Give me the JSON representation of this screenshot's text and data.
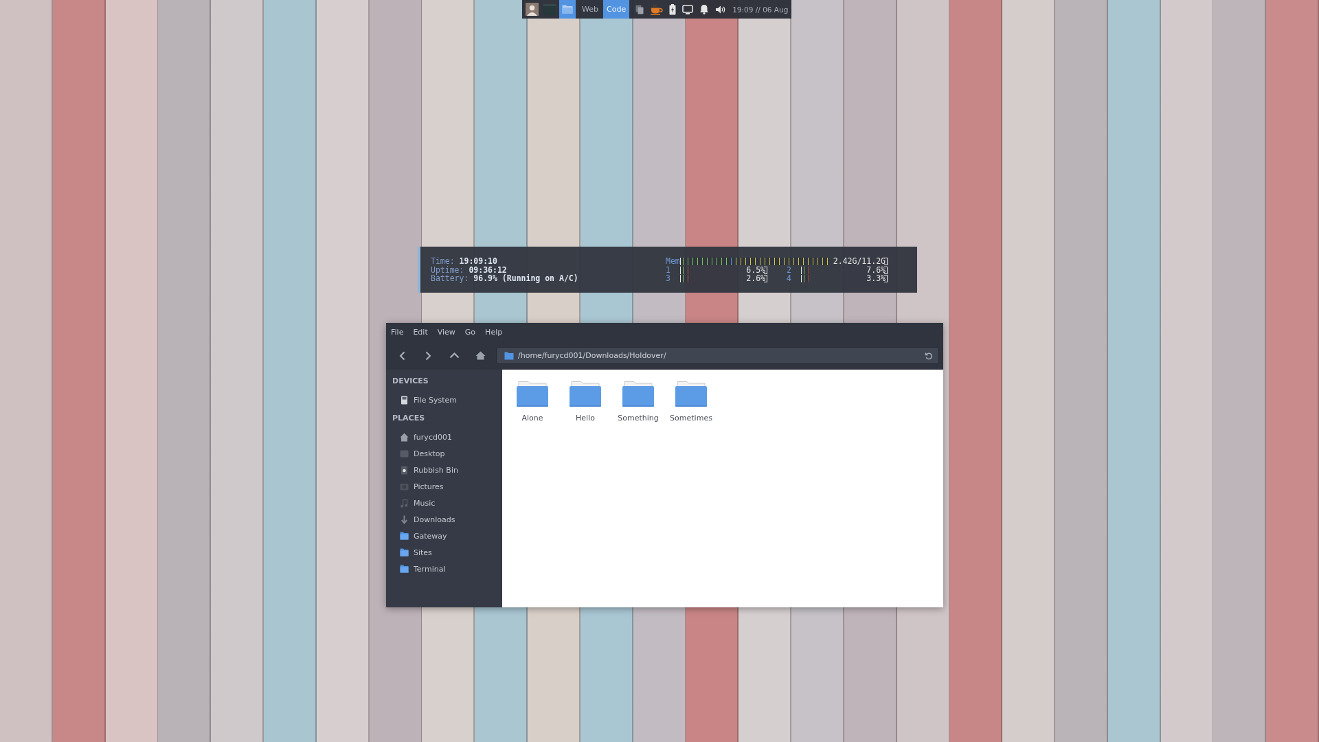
{
  "top_panel": {
    "tasks": [
      {
        "kind": "window",
        "selected": false
      },
      {
        "kind": "folder",
        "selected": true
      }
    ],
    "workspaces": [
      {
        "label": "Web",
        "selected": false
      },
      {
        "label": "Code",
        "selected": true
      }
    ],
    "clock": "19:09 // 06 Aug"
  },
  "system_monitor": {
    "info": [
      {
        "label": "Time:",
        "value": "19:09:10"
      },
      {
        "label": "Uptime:",
        "value": "09:36:12"
      },
      {
        "label": "Battery:",
        "value": "96.9% (Running on A/C)"
      }
    ],
    "memory": {
      "label": "Mem",
      "level": 0.72,
      "reading": "2.42G/11.2G"
    },
    "cpus": [
      {
        "label": "1",
        "level": 0.1,
        "reading": "6.5%"
      },
      {
        "label": "2",
        "level": 0.1,
        "reading": "7.6%"
      },
      {
        "label": "3",
        "level": 0.1,
        "reading": "2.6%"
      },
      {
        "label": "4",
        "level": 0.1,
        "reading": "3.3%"
      }
    ]
  },
  "file_manager": {
    "menu": [
      "File",
      "Edit",
      "View",
      "Go",
      "Help"
    ],
    "location": "/home/furycd001/Downloads/Holdover/",
    "sidebar": [
      {
        "heading": "DEVICES",
        "items": [
          {
            "label": "File System",
            "kind": "drive",
            "selected": false
          }
        ]
      },
      {
        "heading": "PLACES",
        "items": [
          {
            "label": "furycd001",
            "kind": "home",
            "selected": false
          },
          {
            "label": "Desktop",
            "kind": "desktop",
            "selected": false
          },
          {
            "label": "Rubbish Bin",
            "kind": "trash",
            "selected": false
          },
          {
            "label": "Pictures",
            "kind": "pictures",
            "selected": false
          },
          {
            "label": "Music",
            "kind": "music",
            "selected": false
          },
          {
            "label": "Downloads",
            "kind": "downloads",
            "selected": false
          },
          {
            "label": "Gateway",
            "kind": "folder",
            "selected": false
          },
          {
            "label": "Sites",
            "kind": "folder",
            "selected": false
          },
          {
            "label": "Terminal",
            "kind": "folder",
            "selected": false
          }
        ]
      }
    ],
    "files": [
      {
        "name": "Alone",
        "selected": false
      },
      {
        "name": "Hello",
        "selected": false
      },
      {
        "name": "Something",
        "selected": false
      },
      {
        "name": "Sometimes",
        "selected": false
      }
    ]
  }
}
